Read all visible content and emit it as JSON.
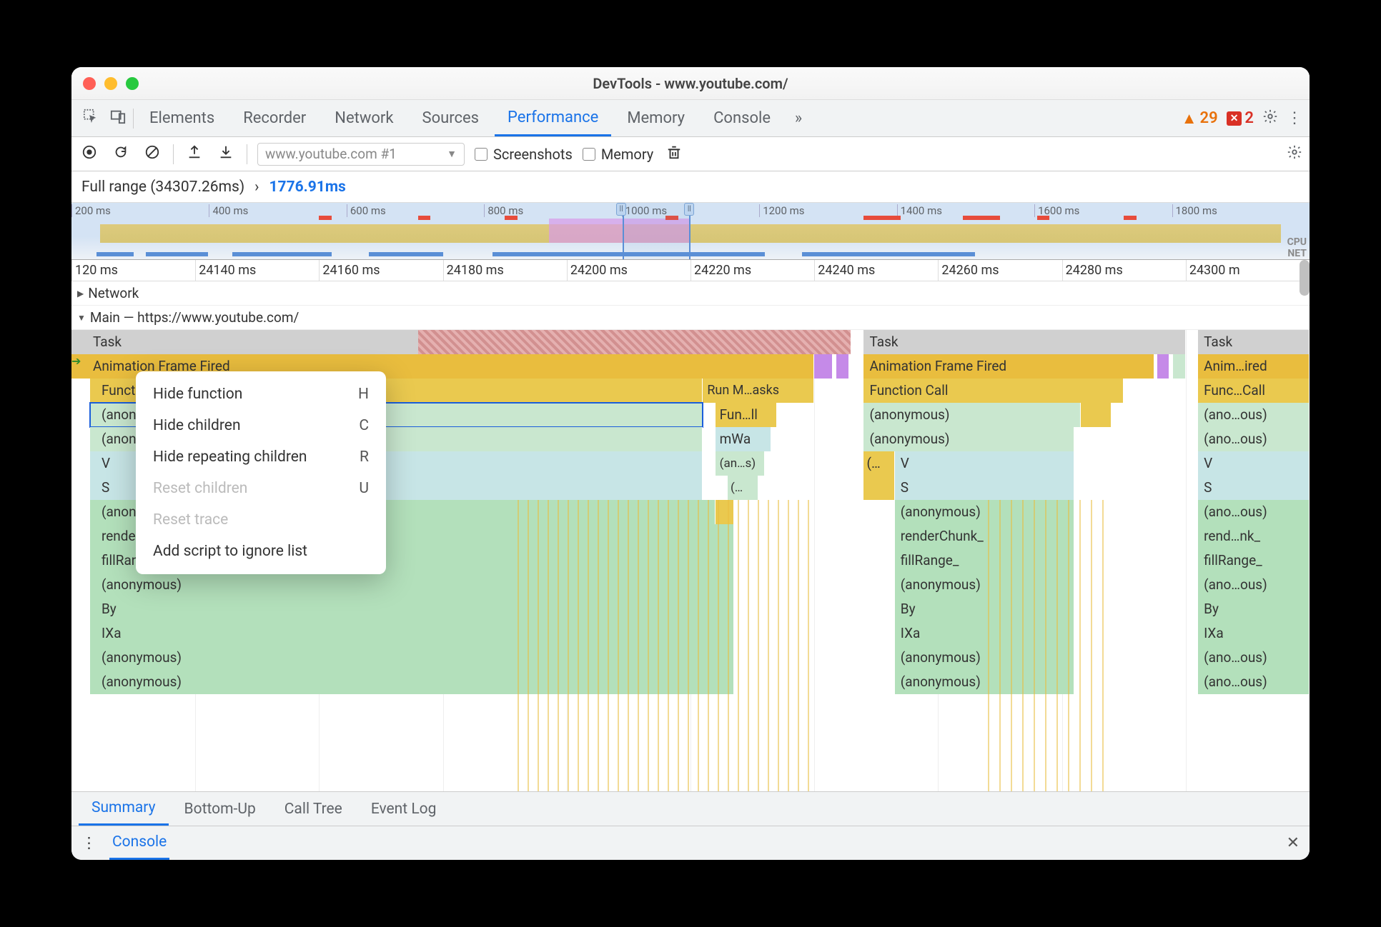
{
  "window_title": "DevTools - www.youtube.com/",
  "tabs": [
    "Elements",
    "Recorder",
    "Network",
    "Sources",
    "Performance",
    "Memory",
    "Console"
  ],
  "active_tab": "Performance",
  "issues": {
    "warnings": 29,
    "errors": 2
  },
  "recording_dropdown": "www.youtube.com #1",
  "checkboxes": {
    "screenshots": "Screenshots",
    "memory": "Memory"
  },
  "breadcrumb": {
    "full_label": "Full range (34307.26ms)",
    "selected": "1776.91ms"
  },
  "overview_ticks": [
    "200 ms",
    "400 ms",
    "600 ms",
    "800 ms",
    "1000 ms",
    "1200 ms",
    "1400 ms",
    "1600 ms",
    "1800 ms"
  ],
  "overview_labels": {
    "cpu": "CPU",
    "net": "NET"
  },
  "detail_ticks": [
    "120 ms",
    "24140 ms",
    "24160 ms",
    "24180 ms",
    "24200 ms",
    "24220 ms",
    "24240 ms",
    "24260 ms",
    "24280 ms",
    "24300 m"
  ],
  "tracks": {
    "network": "Network",
    "main": "Main — https://www.youtube.com/"
  },
  "flame": {
    "col1": {
      "task": "Task",
      "anim": "Animation Frame Fired",
      "fn": "Function Call",
      "run": "Run M…asks",
      "anon1": "(anonymous)",
      "fun": "Fun…ll",
      "anon2": "(anonymous)",
      "mwa": "mWa",
      "v": "V",
      "ans": "(an…s)",
      "s": "S",
      "dots": "(…",
      "anon3": "(anonymous)",
      "render": "renderChunk_",
      "fill": "fillRange_",
      "anon4": "(anonymous)",
      "by": "By",
      "ixa": "IXa",
      "anon5": "(anonymous)",
      "anon6": "(anonymous)"
    },
    "col2": {
      "task": "Task",
      "anim": "Animation Frame Fired",
      "fn": "Function Call",
      "anon1": "(anonymous)",
      "anon2": "(anonymous)",
      "dots": "(…",
      "v": "V",
      "s": "S",
      "anon3": "(anonymous)",
      "render": "renderChunk_",
      "fill": "fillRange_",
      "anon4": "(anonymous)",
      "by": "By",
      "ixa": "IXa",
      "anon5": "(anonymous)",
      "anon6": "(anonymous)"
    },
    "col3": {
      "task": "Task",
      "anim": "Anim…ired",
      "fn": "Func…Call",
      "anon1": "(ano…ous)",
      "anon2": "(ano…ous)",
      "v": "V",
      "s": "S",
      "anon3": "(ano…ous)",
      "render": "rend…nk_",
      "fill": "fillRange_",
      "anon4": "(ano…ous)",
      "by": "By",
      "ixa": "IXa",
      "anon5": "(ano…ous)",
      "anon6": "(ano…ous)"
    }
  },
  "context_menu": [
    {
      "label": "Hide function",
      "shortcut": "H",
      "enabled": true
    },
    {
      "label": "Hide children",
      "shortcut": "C",
      "enabled": true
    },
    {
      "label": "Hide repeating children",
      "shortcut": "R",
      "enabled": true
    },
    {
      "label": "Reset children",
      "shortcut": "U",
      "enabled": false
    },
    {
      "label": "Reset trace",
      "shortcut": "",
      "enabled": false
    },
    {
      "label": "Add script to ignore list",
      "shortcut": "",
      "enabled": true
    }
  ],
  "bottom_tabs": [
    "Summary",
    "Bottom-Up",
    "Call Tree",
    "Event Log"
  ],
  "active_bottom_tab": "Summary",
  "drawer_tab": "Console"
}
